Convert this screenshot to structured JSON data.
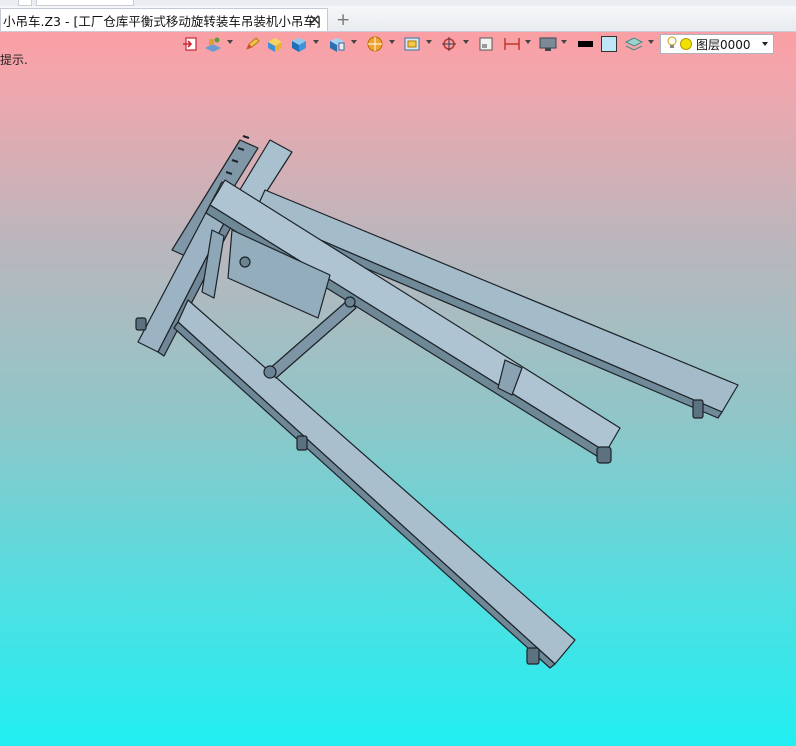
{
  "document_tab": {
    "title": "小吊车.Z3 - [工厂仓库平衡式移动旋转装车吊装机小吊车]",
    "close_glyph": "✕",
    "add_glyph": "+"
  },
  "toolbar": {
    "icons": [
      "import-icon",
      "flat-shade-icon",
      "pencil-edit-icon",
      "box-solid-icon",
      "cube-view-icon",
      "cube-section-icon",
      "sphere-render-icon",
      "frame-view-icon",
      "point-snap-icon",
      "small-square-icon",
      "dimension-icon",
      "monitor-icon",
      "line-color-icon",
      "fill-color-icon",
      "layer-stack-icon"
    ],
    "colors": {
      "line_color": "#000000",
      "fill_color": "#bfe6f6"
    }
  },
  "layer_selector": {
    "value": "图层0000"
  },
  "status_hint": "提示.",
  "viewport": {
    "model": "crane-trolley-3d-model"
  }
}
